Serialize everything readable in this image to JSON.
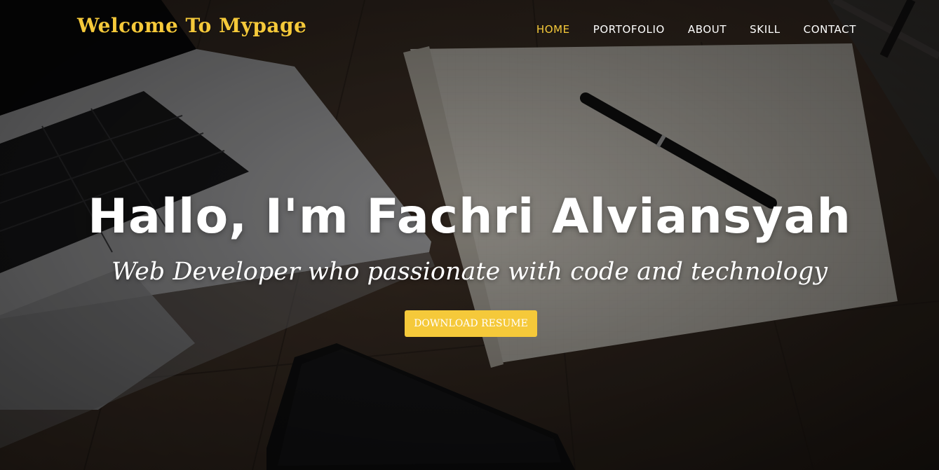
{
  "brand": {
    "title": "Welcome To Mypage",
    "color": "#f5c93a"
  },
  "nav": {
    "items": [
      {
        "label": "HOME",
        "active": true
      },
      {
        "label": "PORTOFOLIO",
        "active": false
      },
      {
        "label": "ABOUT",
        "active": false
      },
      {
        "label": "SKILL",
        "active": false
      },
      {
        "label": "CONTACT",
        "active": false
      }
    ]
  },
  "hero": {
    "headline": "Hallo, I'm Fachri Alviansyah",
    "tagline": "Web Developer who passionate with code and technology",
    "cta_label": "DOWNLOAD RESUME",
    "background_image": "desk-with-laptop-notebook-pen-phone"
  },
  "colors": {
    "accent": "#f5c93a",
    "text": "#ffffff"
  }
}
